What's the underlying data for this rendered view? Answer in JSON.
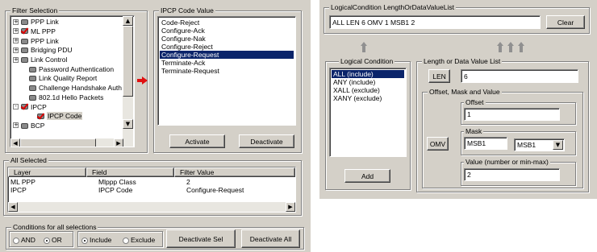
{
  "left": {
    "filter_selection": {
      "title": "Filter Selection",
      "tree": [
        {
          "label": "PPP Link",
          "icon": "gear",
          "expander": "+",
          "indent": 0
        },
        {
          "label": "ML PPP",
          "icon": "check",
          "expander": "+",
          "indent": 0
        },
        {
          "label": "PPP Link",
          "icon": "gear",
          "expander": "+",
          "indent": 0
        },
        {
          "label": "Bridging PDU",
          "icon": "gear",
          "expander": "+",
          "indent": 0
        },
        {
          "label": "Link Control",
          "icon": "gear",
          "expander": "+",
          "indent": 0
        },
        {
          "label": "Password Authentication",
          "icon": "gear",
          "expander": "",
          "indent": 1
        },
        {
          "label": "Link Quality Report",
          "icon": "gear",
          "expander": "",
          "indent": 1
        },
        {
          "label": "Challenge Handshake Auth",
          "icon": "gear",
          "expander": "",
          "indent": 1
        },
        {
          "label": "802.1d Hello Packets",
          "icon": "gear",
          "expander": "",
          "indent": 1
        },
        {
          "label": "IPCP",
          "icon": "check",
          "expander": "-",
          "indent": 0
        },
        {
          "label": "IPCP Code",
          "icon": "check",
          "expander": "",
          "indent": 2
        },
        {
          "label": "BCP",
          "icon": "gear",
          "expander": "+",
          "indent": 0
        }
      ]
    },
    "code_value": {
      "title": "IPCP Code Value",
      "items": [
        "Code-Reject",
        "Configure-Ack",
        "Configure-Nak",
        "Configure-Reject",
        "Configure-Request",
        "Terminate-Ack",
        "Terminate-Request"
      ],
      "selected_index": 4,
      "activate": "Activate",
      "deactivate": "Deactivate"
    },
    "all_selected": {
      "title": "All Selected",
      "columns": [
        "Layer",
        "Field",
        "Filter Value"
      ],
      "rows": [
        [
          "ML PPP",
          "Mlppp Class",
          "2"
        ],
        [
          "IPCP",
          "IPCP Code",
          "Configure-Request"
        ]
      ]
    },
    "conditions": {
      "title": "Conditions for all selections",
      "and": "AND",
      "or": "OR",
      "include": "Include",
      "exclude": "Exclude",
      "deactivate_sel": "Deactivate Sel",
      "deactivate_all": "Deactivate All"
    }
  },
  "right": {
    "lc_list": {
      "title": "LogicalCondition LengthOrDataValueList",
      "value": "ALL  LEN 6  OMV 1 MSB1 2",
      "clear": "Clear"
    },
    "logical_condition": {
      "title": "Logical Condition",
      "items": [
        "ALL (include)",
        "ANY (include)",
        "XALL (exclude)",
        "XANY (exclude)"
      ],
      "selected_index": 0,
      "add": "Add"
    },
    "length_list": {
      "title": "Length or Data Value List",
      "len_button": "LEN",
      "len_value": "6",
      "omv_title": "Offset, Mask and Value",
      "offset_label": "Offset",
      "offset_value": "1",
      "mask_label": "Mask",
      "omv_button": "OMV",
      "mask_value": "MSB1",
      "mask_select": "MSB1",
      "value_label": "Value (number or min-max)",
      "value_value": "2"
    }
  }
}
